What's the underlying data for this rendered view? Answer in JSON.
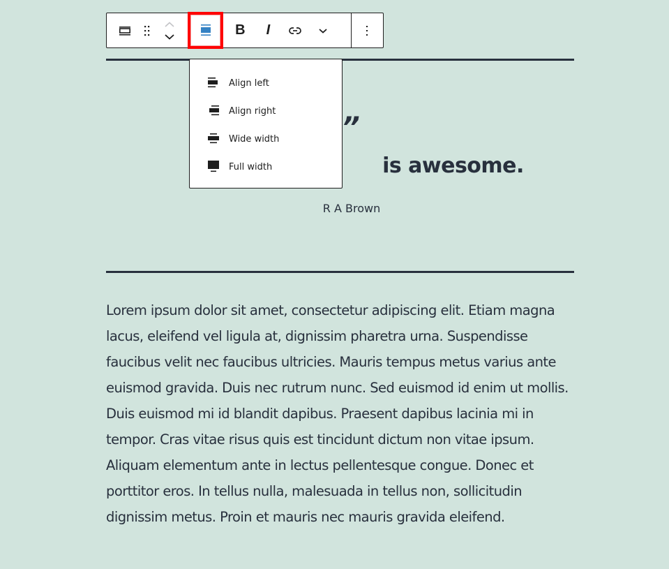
{
  "toolbar": {
    "block_type_icon": "pullquote-icon",
    "drag_handle_icon": "drag-handle-icon",
    "move_up_icon": "chevron-up-icon",
    "move_down_icon": "chevron-down-icon",
    "align_icon": "align-center-icon",
    "bold_label": "B",
    "italic_label": "I",
    "link_icon": "link-icon",
    "more_rich_text_icon": "chevron-down-icon",
    "options_icon": "more-vertical-icon",
    "highlight_color": "#ff0000",
    "active_color": "#3582c4"
  },
  "align_menu": {
    "items": [
      {
        "label": "Align left",
        "icon": "align-left-icon"
      },
      {
        "label": "Align right",
        "icon": "align-right-icon"
      },
      {
        "label": "Wide width",
        "icon": "align-wide-icon"
      },
      {
        "label": "Full width",
        "icon": "align-full-icon"
      }
    ]
  },
  "pullquote": {
    "quote_mark": "”",
    "visible_text": "is awesome.",
    "citation": "R A Brown"
  },
  "paragraph": {
    "text": "Lorem ipsum dolor sit amet, consectetur adipiscing elit. Etiam magna lacus, eleifend vel ligula at, dignissim pharetra urna. Suspendisse faucibus velit nec faucibus ultricies. Mauris tempus metus varius ante euismod gravida. Duis nec rutrum nunc. Sed euismod id enim ut mollis. Duis euismod mi id blandit dapibus. Praesent dapibus lacinia mi in tempor. Cras vitae risus quis est tincidunt dictum non vitae ipsum. Aliquam elementum ante in lectus pellentesque congue. Donec et porttitor eros. In tellus nulla, malesuada in tellus non, sollicitudin dignissim metus. Proin et mauris nec mauris gravida eleifend."
  },
  "colors": {
    "background": "#d1e4dd",
    "text": "#28303d"
  }
}
